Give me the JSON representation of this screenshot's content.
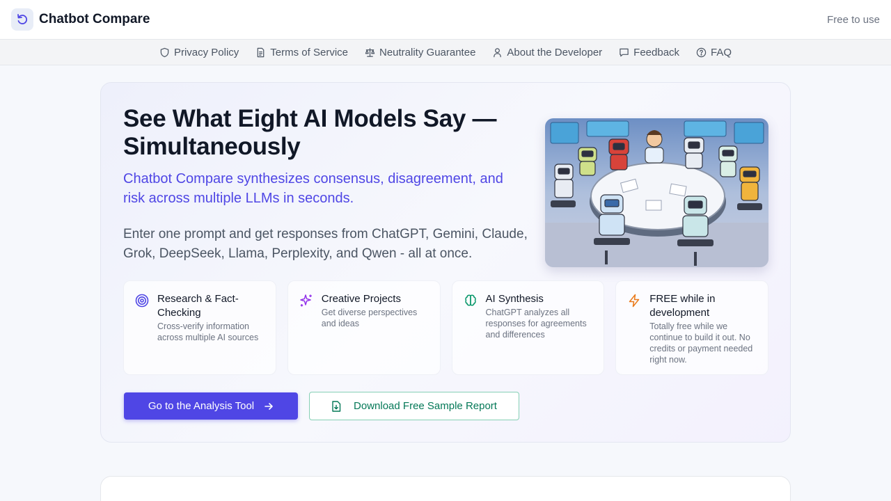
{
  "header": {
    "title": "Chatbot Compare",
    "logo_icon": "refresh-icon",
    "right_label": "Free to use"
  },
  "nav": {
    "items": [
      {
        "label": "Privacy Policy",
        "icon": "shield-icon"
      },
      {
        "label": "Terms of Service",
        "icon": "document-icon"
      },
      {
        "label": "Neutrality Guarantee",
        "icon": "scale-icon"
      },
      {
        "label": "About the Developer",
        "icon": "user-icon"
      },
      {
        "label": "Feedback",
        "icon": "chat-icon"
      },
      {
        "label": "FAQ",
        "icon": "help-icon"
      }
    ]
  },
  "hero": {
    "title": "See What Eight AI Models Say — Simultaneously",
    "subtitle": "Chatbot Compare synthesizes consensus, disagreement, and risk across multiple LLMs in seconds.",
    "description": "Enter one prompt and get responses from ChatGPT, Gemini, Claude, Grok, DeepSeek, Llama, Perplexity, and Qwen - all at once."
  },
  "features": [
    {
      "title": "Research & Fact-Checking",
      "desc": "Cross-verify information across multiple AI sources",
      "icon": "target-icon",
      "color": "#4f46e5"
    },
    {
      "title": "Creative Projects",
      "desc": "Get diverse perspectives and ideas",
      "icon": "sparkles-icon",
      "color": "#9333ea"
    },
    {
      "title": "AI Synthesis",
      "desc": "ChatGPT analyzes all responses for agreements and differences",
      "icon": "brain-icon",
      "color": "#059669"
    },
    {
      "title": "FREE while in development",
      "desc": "Totally free while we continue to build it out. No credits or payment needed right now.",
      "icon": "lightning-icon",
      "color": "#ea7a1a"
    }
  ],
  "buttons": {
    "primary": "Go to the Analysis Tool",
    "secondary": "Download Free Sample Report"
  },
  "colors": {
    "accent": "#4f46e5",
    "green": "#047857"
  }
}
